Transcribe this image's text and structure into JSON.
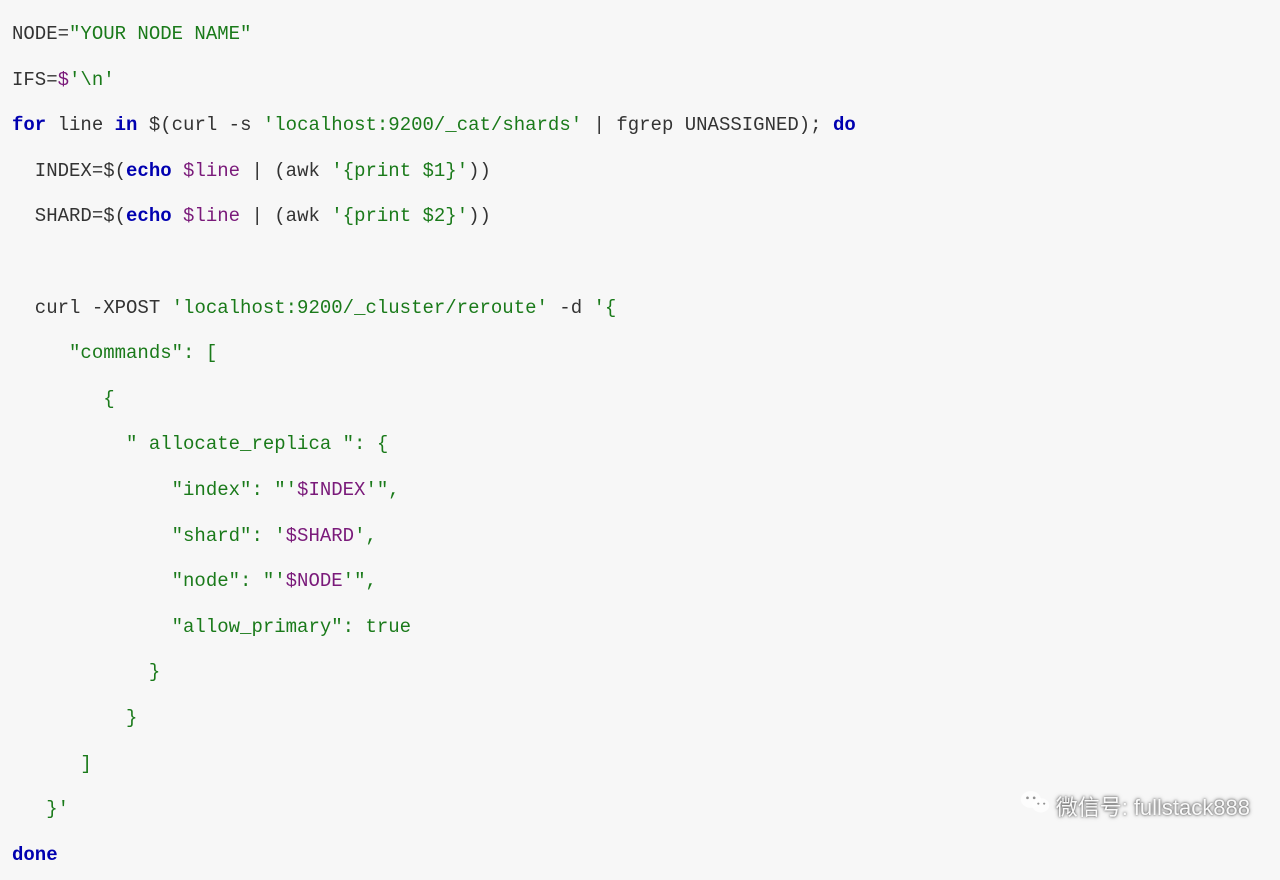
{
  "code": {
    "l1": {
      "a": "NODE=",
      "b": "\"YOUR NODE NAME\""
    },
    "l2": {
      "a": "IFS=",
      "b": "$",
      "c": "'\\n'"
    },
    "l3": {
      "a": "for",
      "b": " line ",
      "c": "in",
      "d": " $(curl -s ",
      "e": "'localhost:9200/_cat/shards'",
      "f": " | fgrep UNASSIGNED); ",
      "g": "do"
    },
    "l4": {
      "a": "  INDEX=$(",
      "b": "echo",
      "c": " ",
      "d": "$line",
      "e": " | (awk ",
      "f": "'{print $1}'",
      "g": "))"
    },
    "l5": {
      "a": "  SHARD=$(",
      "b": "echo",
      "c": " ",
      "d": "$line",
      "e": " | (awk ",
      "f": "'{print $2}'",
      "g": "))"
    },
    "l6": "",
    "l7": {
      "a": "  curl -XPOST ",
      "b": "'localhost:9200/_cluster/reroute'",
      "c": " -d ",
      "d": "'{"
    },
    "l8": {
      "a": "     \"commands\": ["
    },
    "l9": {
      "a": "        {"
    },
    "l10": {
      "a": "          \" allocate_replica \": {"
    },
    "l11": {
      "a": "              \"index\": \"'",
      "b": "$INDEX",
      "c": "'\","
    },
    "l12": {
      "a": "              \"shard\": '",
      "b": "$SHARD",
      "c": "',"
    },
    "l13": {
      "a": "              \"node\": \"'",
      "b": "$NODE",
      "c": "'\","
    },
    "l14": {
      "a": "              \"allow_primary\": true"
    },
    "l15": {
      "a": "            }"
    },
    "l16": {
      "a": "          }"
    },
    "l17": {
      "a": "      ]"
    },
    "l18": {
      "a": "   }'"
    },
    "l19": {
      "a": "done"
    }
  },
  "watermark": {
    "label": "微信号:",
    "id": "fullstack888"
  }
}
